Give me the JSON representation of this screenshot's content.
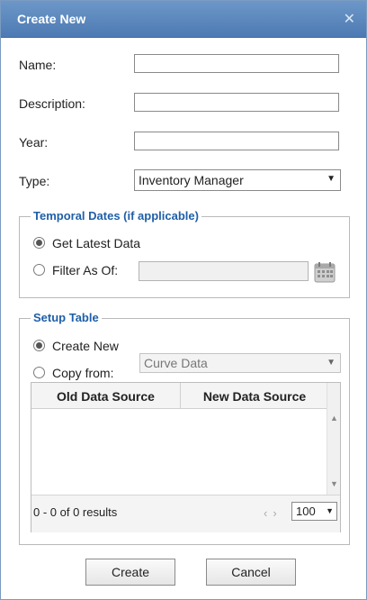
{
  "dialog": {
    "title": "Create New",
    "close_glyph": "✕"
  },
  "form": {
    "name_label": "Name:",
    "name_value": "",
    "description_label": "Description:",
    "description_value": "",
    "year_label": "Year:",
    "year_value": "",
    "type_label": "Type:",
    "type_selected": "Inventory Manager"
  },
  "temporal": {
    "legend": "Temporal Dates (if applicable)",
    "get_latest_label": "Get Latest Data",
    "get_latest_selected": true,
    "filter_label": "Filter As Of:",
    "filter_selected": false,
    "filter_date": ""
  },
  "setup": {
    "legend": "Setup Table",
    "create_new_label": "Create New",
    "create_new_selected": true,
    "copy_from_label": "Copy from:",
    "copy_from_selected": false,
    "copy_from_value": "Curve Data",
    "grid": {
      "columns": [
        "Old Data Source",
        "New Data Source"
      ],
      "rows": [],
      "results_text": "0 - 0 of 0 results",
      "page_size": "100"
    }
  },
  "buttons": {
    "create": "Create",
    "cancel": "Cancel"
  },
  "icons": {
    "close": "close-icon",
    "calendar": "calendar-icon",
    "dropdown": "chevron-down-icon"
  },
  "colors": {
    "titlebar": "#5a86bd",
    "legend_text": "#1f5fa8"
  }
}
